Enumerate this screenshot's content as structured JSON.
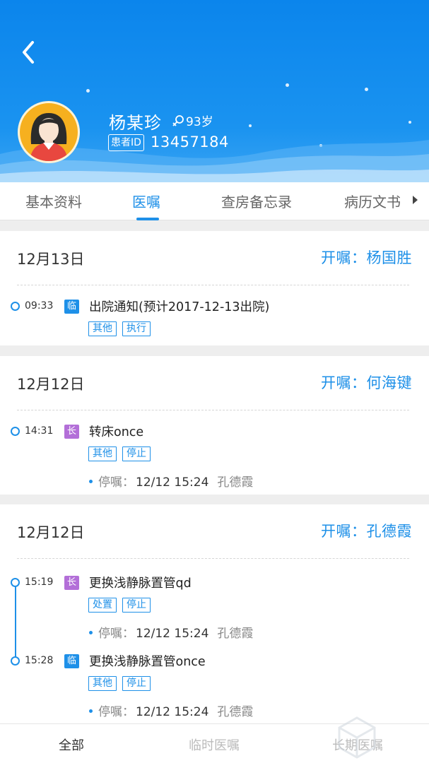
{
  "header": {
    "patient_name": "杨某珍",
    "age": "93岁",
    "id_label": "患者ID",
    "patient_id": "13457184",
    "colors": {
      "primary": "#1e90e8",
      "long_term": "#b36fd8"
    }
  },
  "tabs": [
    {
      "label": "基本资料"
    },
    {
      "label": "医嘱"
    },
    {
      "label": "查房备忘录"
    },
    {
      "label": "病历文书"
    }
  ],
  "groups": [
    {
      "date": "12月13日",
      "doctor": "开嘱：杨国胜",
      "orders": [
        {
          "time": "09:33",
          "type": "临",
          "title": "出院通知(预计2017-12-13出院)",
          "tags": [
            "其他",
            "执行"
          ]
        }
      ]
    },
    {
      "date": "12月12日",
      "doctor": "开嘱：何海键",
      "orders": [
        {
          "time": "14:31",
          "type": "长",
          "title": "转床once",
          "tags": [
            "其他",
            "停止"
          ],
          "stop_label": "停嘱：",
          "stop_time": "12/12 15:24",
          "stop_by": "孔德霞"
        }
      ]
    },
    {
      "date": "12月12日",
      "doctor": "开嘱：孔德霞",
      "orders": [
        {
          "time": "15:19",
          "type": "长",
          "title": "更换浅静脉置管qd",
          "tags": [
            "处置",
            "停止"
          ],
          "stop_label": "停嘱：",
          "stop_time": "12/12 15:24",
          "stop_by": "孔德霞"
        },
        {
          "time": "15:28",
          "type": "临",
          "title": "更换浅静脉置管once",
          "tags": [
            "其他",
            "停止"
          ],
          "stop_label": "停嘱：",
          "stop_time": "12/12 15:24",
          "stop_by": "孔德霞"
        }
      ]
    }
  ],
  "bottom_tabs": [
    {
      "label": "全部"
    },
    {
      "label": "临时医嘱"
    },
    {
      "label": "长期医嘱"
    }
  ]
}
